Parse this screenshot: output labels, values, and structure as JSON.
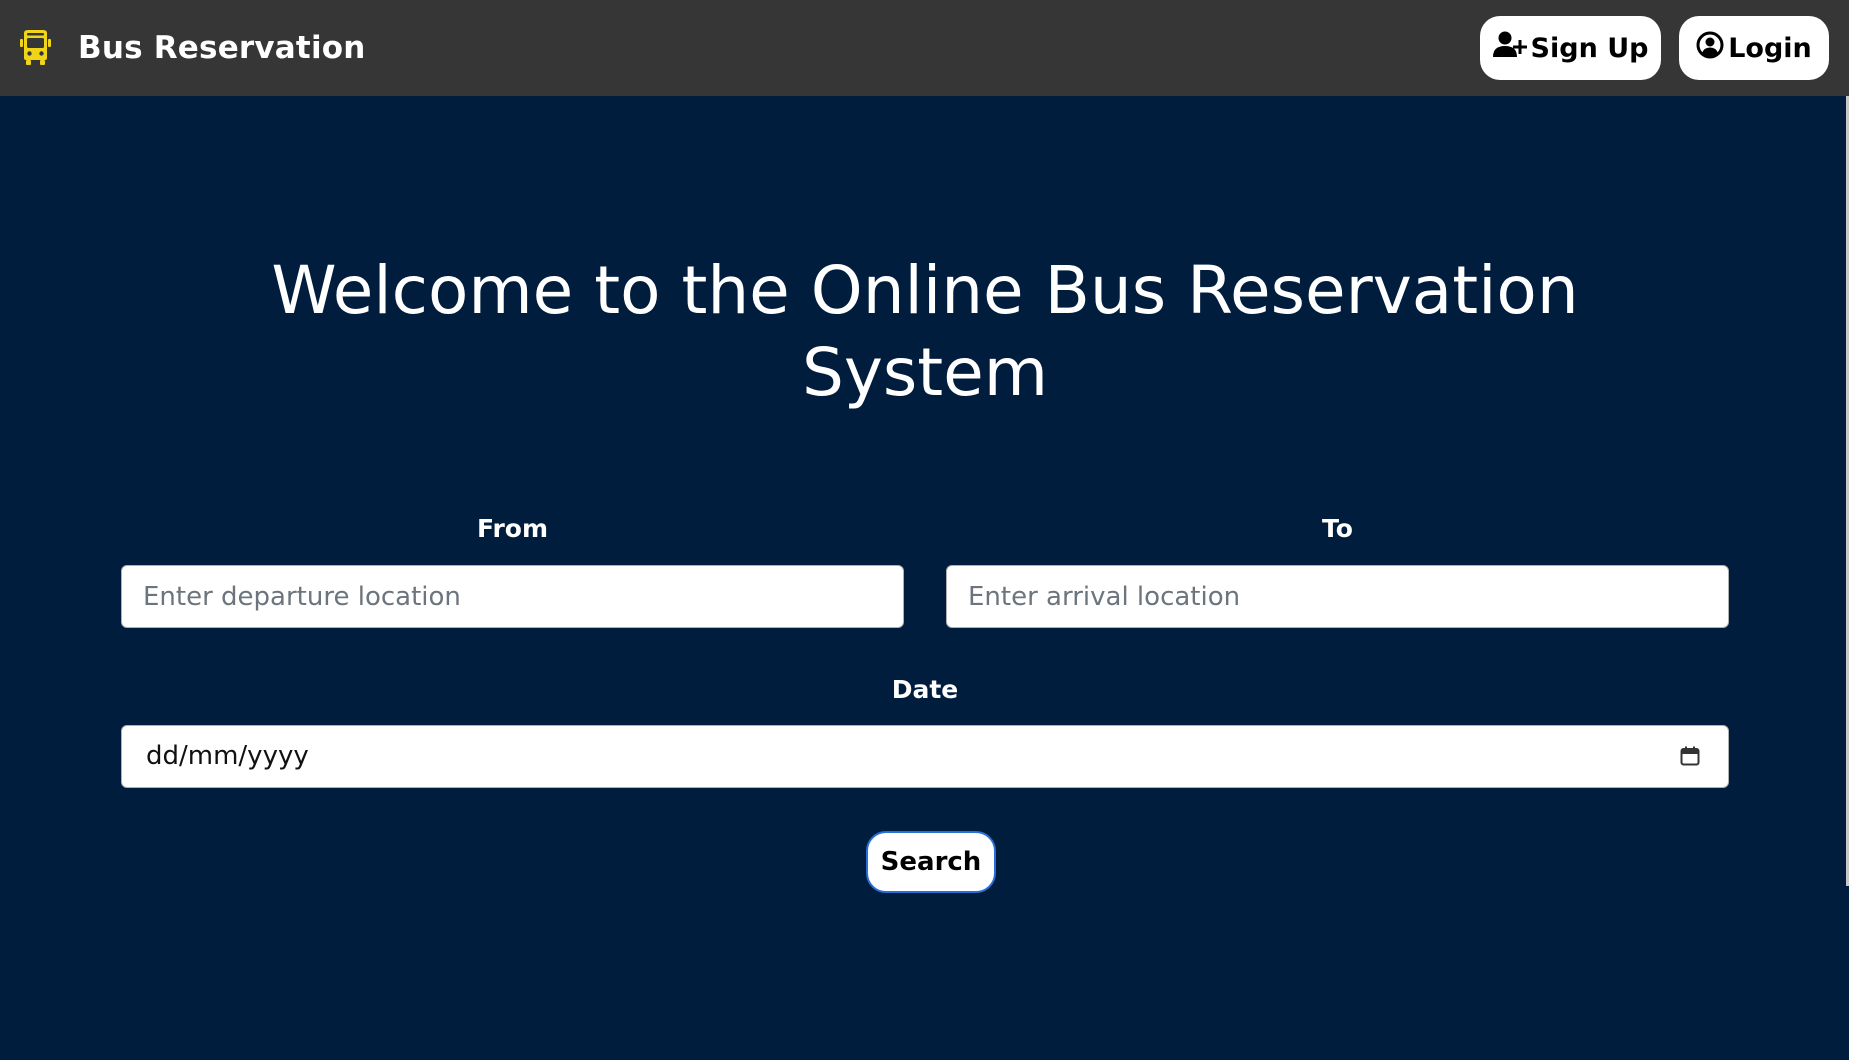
{
  "navbar": {
    "brand_icon": "bus-icon",
    "brand_title": "Bus Reservation",
    "signup_icon": "user-plus-icon",
    "signup_label": "Sign Up",
    "login_icon": "user-circle-icon",
    "login_label": "Login"
  },
  "hero": {
    "title": "Welcome to the Online Bus Reservation System"
  },
  "form": {
    "from_label": "From",
    "from_placeholder": "Enter departure location",
    "from_value": "",
    "to_label": "To",
    "to_placeholder": "Enter arrival location",
    "to_value": "",
    "date_label": "Date",
    "date_value": "dd/mm/yyyy",
    "date_icon": "calendar-icon",
    "search_label": "Search"
  },
  "colors": {
    "navbar_bg": "#363636",
    "page_bg": "#001d3d",
    "brand_icon": "#f0d418",
    "button_bg": "#ffffff",
    "search_border": "#2a6fd6"
  }
}
